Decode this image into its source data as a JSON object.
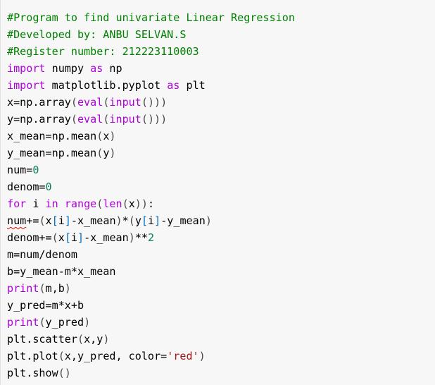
{
  "colors": {
    "background": "#f7f7f7",
    "comment": "#008000",
    "keyword": "#af00db",
    "number": "#098658",
    "string": "#a31515",
    "error_underline": "#e51400"
  },
  "code_lines": [
    [
      {
        "t": "#Program to find univariate Linear Regression",
        "c": "comment"
      }
    ],
    [
      {
        "t": "#Developed by: ANBU SELVAN.S",
        "c": "comment"
      }
    ],
    [
      {
        "t": "#Register number: 212223110003",
        "c": "comment"
      }
    ],
    [
      {
        "t": "import",
        "c": "keyword"
      },
      {
        "t": " numpy ",
        "c": "plain"
      },
      {
        "t": "as",
        "c": "keyword"
      },
      {
        "t": " np",
        "c": "plain"
      }
    ],
    [
      {
        "t": "import",
        "c": "keyword"
      },
      {
        "t": " matplotlib.pyplot ",
        "c": "plain"
      },
      {
        "t": "as",
        "c": "keyword"
      },
      {
        "t": " plt",
        "c": "plain"
      }
    ],
    [
      {
        "t": "x=np.array",
        "c": "plain"
      },
      {
        "t": "(",
        "c": "paren"
      },
      {
        "t": "eval",
        "c": "func"
      },
      {
        "t": "(",
        "c": "paren"
      },
      {
        "t": "input",
        "c": "func"
      },
      {
        "t": "()))",
        "c": "paren"
      }
    ],
    [
      {
        "t": "y=np.array",
        "c": "plain"
      },
      {
        "t": "(",
        "c": "paren"
      },
      {
        "t": "eval",
        "c": "func"
      },
      {
        "t": "(",
        "c": "paren"
      },
      {
        "t": "input",
        "c": "func"
      },
      {
        "t": "()))",
        "c": "paren"
      }
    ],
    [
      {
        "t": "x_mean=np.mean",
        "c": "plain"
      },
      {
        "t": "(",
        "c": "paren"
      },
      {
        "t": "x",
        "c": "plain"
      },
      {
        "t": ")",
        "c": "paren"
      }
    ],
    [
      {
        "t": "y_mean=np.mean",
        "c": "plain"
      },
      {
        "t": "(",
        "c": "paren"
      },
      {
        "t": "y",
        "c": "plain"
      },
      {
        "t": ")",
        "c": "paren"
      }
    ],
    [
      {
        "t": "num=",
        "c": "plain"
      },
      {
        "t": "0",
        "c": "number"
      }
    ],
    [
      {
        "t": "denom=",
        "c": "plain"
      },
      {
        "t": "0",
        "c": "number"
      }
    ],
    [
      {
        "t": "for",
        "c": "keyword"
      },
      {
        "t": " i ",
        "c": "plain"
      },
      {
        "t": "in",
        "c": "keyword"
      },
      {
        "t": " ",
        "c": "plain"
      },
      {
        "t": "range",
        "c": "func"
      },
      {
        "t": "(",
        "c": "paren"
      },
      {
        "t": "len",
        "c": "func"
      },
      {
        "t": "(",
        "c": "paren"
      },
      {
        "t": "x",
        "c": "plain"
      },
      {
        "t": "))",
        "c": "paren"
      },
      {
        "t": ":",
        "c": "plain"
      }
    ],
    [
      {
        "t": "num",
        "c": "plain",
        "err": true
      },
      {
        "t": "+=",
        "c": "plain"
      },
      {
        "t": "(",
        "c": "paren"
      },
      {
        "t": "x",
        "c": "plain"
      },
      {
        "t": "[",
        "c": "bracket"
      },
      {
        "t": "i",
        "c": "plain"
      },
      {
        "t": "]",
        "c": "bracket"
      },
      {
        "t": "-x_mean",
        "c": "plain"
      },
      {
        "t": ")",
        "c": "paren"
      },
      {
        "t": "*",
        "c": "plain"
      },
      {
        "t": "(",
        "c": "paren"
      },
      {
        "t": "y",
        "c": "plain"
      },
      {
        "t": "[",
        "c": "bracket"
      },
      {
        "t": "i",
        "c": "plain"
      },
      {
        "t": "]",
        "c": "bracket"
      },
      {
        "t": "-y_mean",
        "c": "plain"
      },
      {
        "t": ")",
        "c": "paren"
      }
    ],
    [
      {
        "t": "denom+=",
        "c": "plain"
      },
      {
        "t": "(",
        "c": "paren"
      },
      {
        "t": "x",
        "c": "plain"
      },
      {
        "t": "[",
        "c": "bracket"
      },
      {
        "t": "i",
        "c": "plain"
      },
      {
        "t": "]",
        "c": "bracket"
      },
      {
        "t": "-x_mean",
        "c": "plain"
      },
      {
        "t": ")",
        "c": "paren"
      },
      {
        "t": "**",
        "c": "plain"
      },
      {
        "t": "2",
        "c": "number"
      }
    ],
    [
      {
        "t": "m=num/denom",
        "c": "plain"
      }
    ],
    [
      {
        "t": "b=y_mean-m*x_mean",
        "c": "plain"
      }
    ],
    [
      {
        "t": "print",
        "c": "func"
      },
      {
        "t": "(",
        "c": "paren"
      },
      {
        "t": "m,b",
        "c": "plain"
      },
      {
        "t": ")",
        "c": "paren"
      }
    ],
    [
      {
        "t": "y_pred=m*x+b",
        "c": "plain"
      }
    ],
    [
      {
        "t": "print",
        "c": "func"
      },
      {
        "t": "(",
        "c": "paren"
      },
      {
        "t": "y_pred",
        "c": "plain"
      },
      {
        "t": ")",
        "c": "paren"
      }
    ],
    [
      {
        "t": "plt.scatter",
        "c": "plain"
      },
      {
        "t": "(",
        "c": "paren"
      },
      {
        "t": "x,y",
        "c": "plain"
      },
      {
        "t": ")",
        "c": "paren"
      }
    ],
    [
      {
        "t": "plt.plot",
        "c": "plain"
      },
      {
        "t": "(",
        "c": "paren"
      },
      {
        "t": "x,y_pred, color=",
        "c": "plain"
      },
      {
        "t": "'red'",
        "c": "string"
      },
      {
        "t": ")",
        "c": "paren"
      }
    ],
    [
      {
        "t": "plt.show",
        "c": "plain"
      },
      {
        "t": "()",
        "c": "paren"
      }
    ]
  ]
}
